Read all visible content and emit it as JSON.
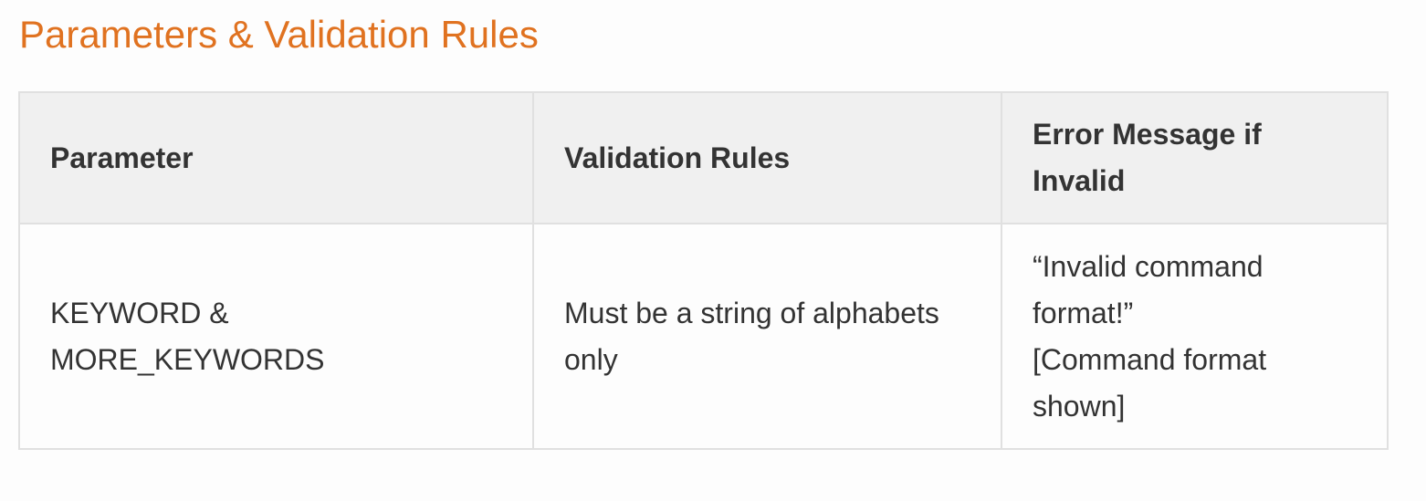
{
  "section": {
    "title": "Parameters & Validation Rules"
  },
  "table": {
    "headers": {
      "parameter": "Parameter",
      "validation": "Validation Rules",
      "error_line1": "Error Message if",
      "error_line2": "Invalid"
    },
    "rows": [
      {
        "parameter_line1": "KEYWORD &",
        "parameter_line2": "MORE_KEYWORDS",
        "validation_line1": "Must be a string of alphabets",
        "validation_line2": "only",
        "error_line1": "“Invalid command",
        "error_line2": "format!”",
        "error_line3": "[Command format",
        "error_line4": "shown]"
      }
    ]
  },
  "colors": {
    "title": "#e07220",
    "text": "#333333",
    "header_bg": "#f0f0f0",
    "border": "#e0e0e0",
    "page_bg": "#fdfdfd"
  }
}
